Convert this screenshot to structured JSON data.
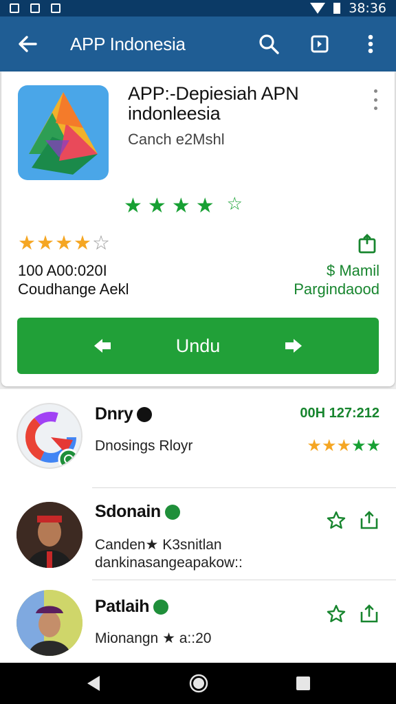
{
  "status_bar": {
    "time": "38:36"
  },
  "app_bar": {
    "title": "APP Indonesia"
  },
  "app_card": {
    "title": "APP:-Depiesiah APN indonleesia",
    "subtitle": "Canch e2Mshl",
    "green_rating": 4,
    "rating_stars": 4,
    "meta_left_line1": "100 A00:020I",
    "meta_left_line2": "Coudhange Aekl",
    "meta_right_line1": "$ Mamil",
    "meta_right_line2": "Pargindaood",
    "install_label": "Undu"
  },
  "list": [
    {
      "name": "Dnry",
      "subtitle": "Dnosings Rloyr",
      "right_text": "00H 127:212",
      "rating": 5
    },
    {
      "name": "Sdonain",
      "subtitle_line1": "Canden★ K3snitlan",
      "subtitle_line2": "dankinasangeapakow::"
    },
    {
      "name": "Patlaih",
      "subtitle_line1": "Mionangn ★ a::20"
    }
  ],
  "colors": {
    "primary": "#1f5d94",
    "status": "#0b3a66",
    "accent_green": "#21a038",
    "star_orange": "#f5a623"
  },
  "icons": [
    "back-arrow-icon",
    "search-icon",
    "download-icon",
    "more-vert-icon",
    "share-icon",
    "star-icon",
    "verified-badge-icon",
    "nav-back-icon",
    "nav-home-icon",
    "nav-recents-icon"
  ]
}
